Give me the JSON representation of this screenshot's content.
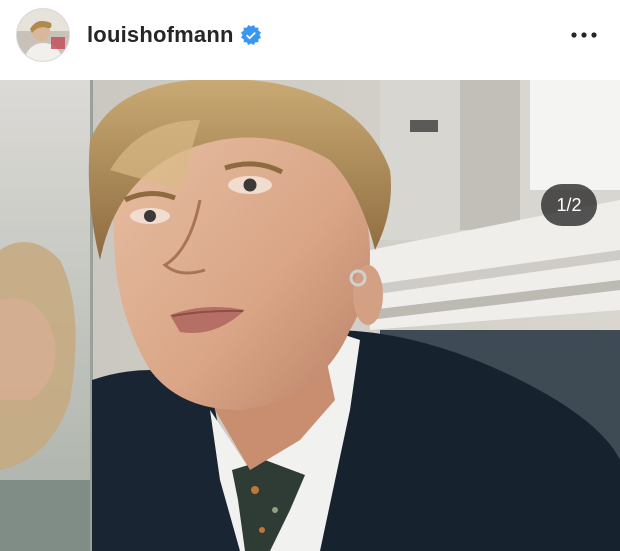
{
  "post": {
    "username": "louishofmann",
    "verified": true,
    "more_icon": "more-horizontal-icon",
    "carousel_counter": "1/2"
  },
  "colors": {
    "verified_blue": "#3897f0",
    "text": "#262626",
    "counter_bg": "#262626"
  }
}
